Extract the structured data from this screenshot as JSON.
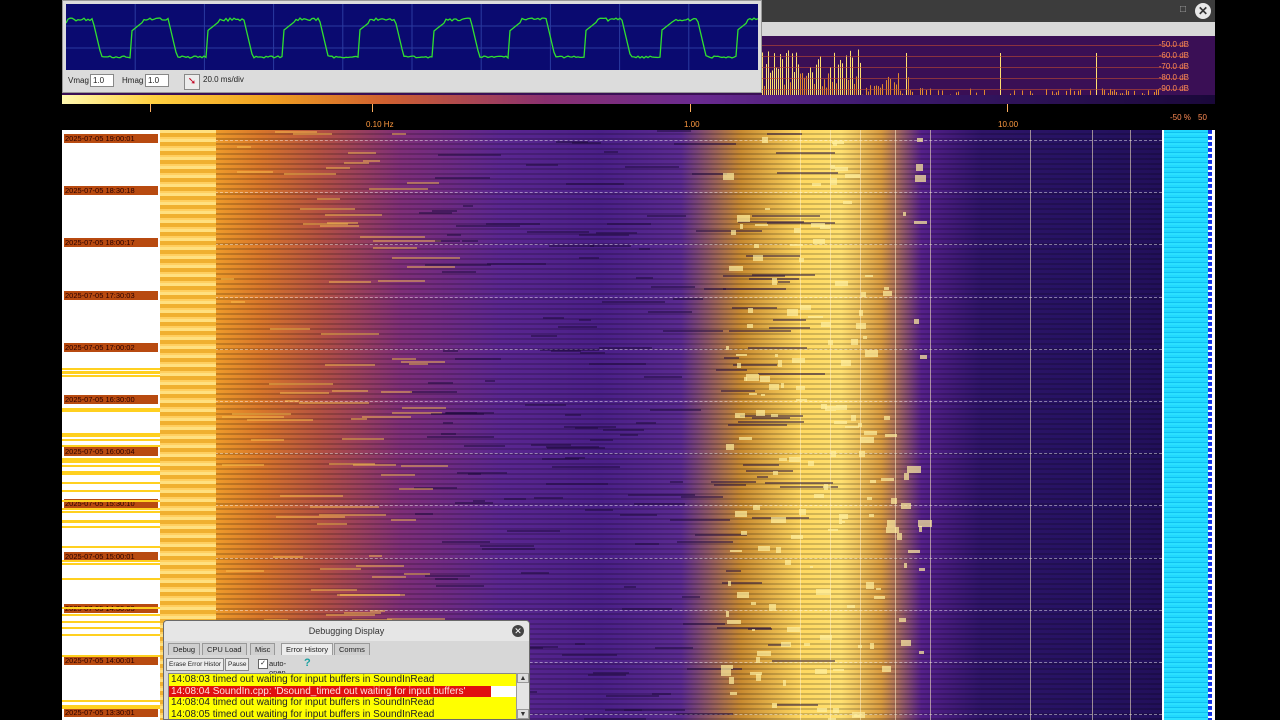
{
  "scope": {
    "vmag_label": "Vmag",
    "vmag_value": "1.0",
    "hmag_label": "Hmag",
    "hmag_value": "1.0",
    "time_div": "20.0 ms/div"
  },
  "spectrum": {
    "db_levels": [
      "-50.0 dB",
      "-60.0 dB",
      "-70.0 dB",
      "-80.0 dB",
      "-90.0 dB"
    ]
  },
  "freq_axis": {
    "labels": [
      "0.10 Hz",
      "1.00",
      "10.00"
    ]
  },
  "meter": {
    "label_a": "-50 %",
    "label_b": "50"
  },
  "waterfall": {
    "time_labels": [
      "2025-07-05 19:00:01",
      "2025-07-05 18:30:18",
      "2025-07-05 18:00:17",
      "2025-07-05 17:30:03",
      "2025-07-05 17:00:02",
      "2025-07-05 16:30:00",
      "2025-07-05 16:00:04",
      "2025-07-05 15:30:10",
      "2025-07-05 15:00:01",
      "2025-07-05 14:30:03",
      "2025-07-05 14:00:01",
      "2025-07-05 13:30:01"
    ]
  },
  "debug": {
    "title": "Debugging Display",
    "tabs": [
      "Debug",
      "CPU Load",
      "Misc",
      "Error History",
      "Comms"
    ],
    "active_tab": "Error History",
    "erase_button": "Erase Error Histor",
    "pause_button": "Pause",
    "autoopen_label": "auto-open",
    "log": [
      {
        "text": "14:08:03 timed out waiting for input buffers in SoundInRead",
        "level": "warn"
      },
      {
        "text": "14:08:04 SoundIn.cpp: 'Dsound_timed out waiting for input buffers'",
        "level": "err"
      },
      {
        "text": "14:08:04 timed out waiting for input buffers in SoundInRead",
        "level": "warn"
      },
      {
        "text": "14:08:05 timed out waiting for input buffers in SoundInRead",
        "level": "warn"
      }
    ]
  },
  "colors": {
    "accent": "#ff9a40",
    "meter": "#22d8ff",
    "warn_bg": "#ffff00",
    "err_bg": "#e01010"
  }
}
